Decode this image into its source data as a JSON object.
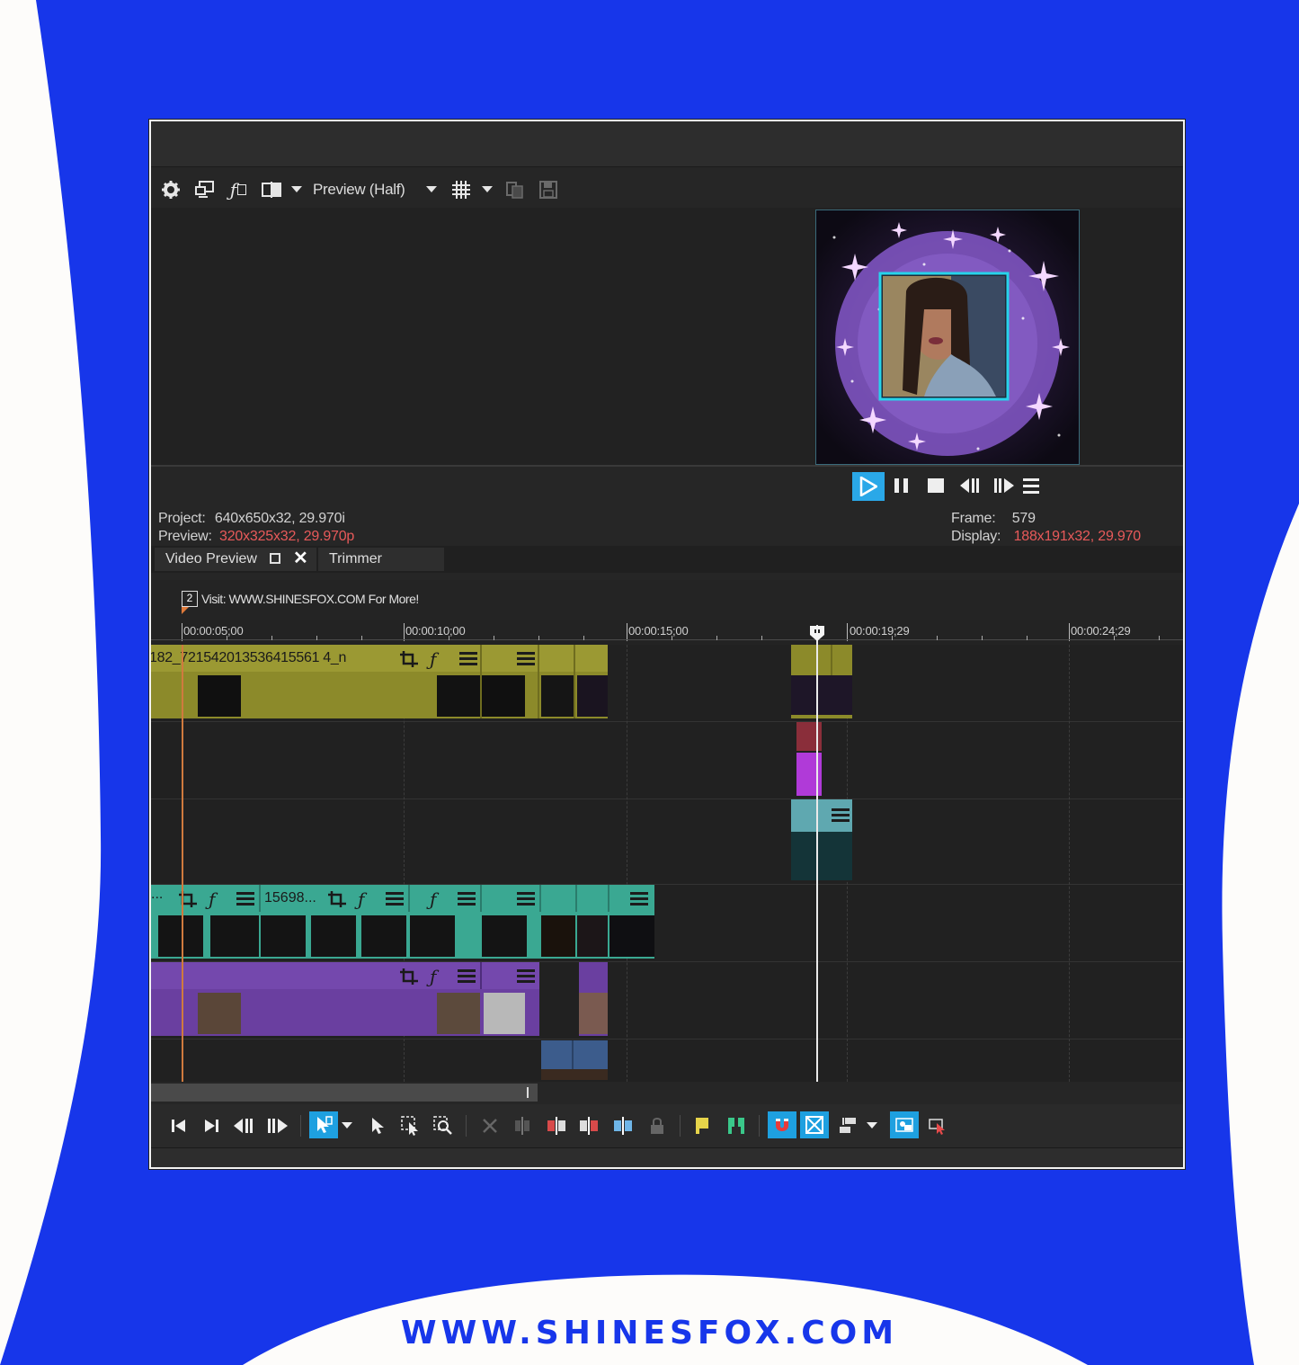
{
  "toolbar": {
    "preview_quality": "Preview (Half)",
    "icons": [
      "settings-icon",
      "external-monitor-icon",
      "video-fx-icon",
      "split-screen-icon",
      "dropdown-icon",
      "grid-overlay-icon",
      "copy-snapshot-icon",
      "save-snapshot-icon"
    ]
  },
  "transport": {
    "icons": [
      "play-icon",
      "pause-icon",
      "stop-icon",
      "previous-frame-icon",
      "next-frame-icon",
      "menu-icon"
    ]
  },
  "info": {
    "project_label": "Project:",
    "project_value": "640x650x32, 29.970i",
    "preview_label": "Preview:",
    "preview_value": "320x325x32, 29.970p",
    "frame_label": "Frame:",
    "frame_value": "579",
    "display_label": "Display:",
    "display_value": "188x191x32, 29.970"
  },
  "tabs": {
    "video_preview": "Video Preview",
    "trimmer": "Trimmer"
  },
  "marker": {
    "number": "2",
    "text": "Visit: WWW.SHINESFOX.COM For More!"
  },
  "timeline": {
    "timecodes": [
      "00:00:05;00",
      "00:00:10;00",
      "00:00:15;00",
      "00:00:19;29",
      "00:00:24;29"
    ]
  },
  "clips": {
    "track1_label": "182_721542013536415561 4_n",
    "track4_label_a": "...",
    "track4_label_b": "15698..."
  },
  "footer": "WWW.SHINESFOX.COM",
  "colors": {
    "background_blue": "#1736ea",
    "olive_clip": "#8c8a2a",
    "teal_clip": "#3aa892",
    "purple_clip": "#6a3fa0",
    "playhead_cursor": "#e07a3a",
    "accent_cyan": "#1ea0e0"
  }
}
